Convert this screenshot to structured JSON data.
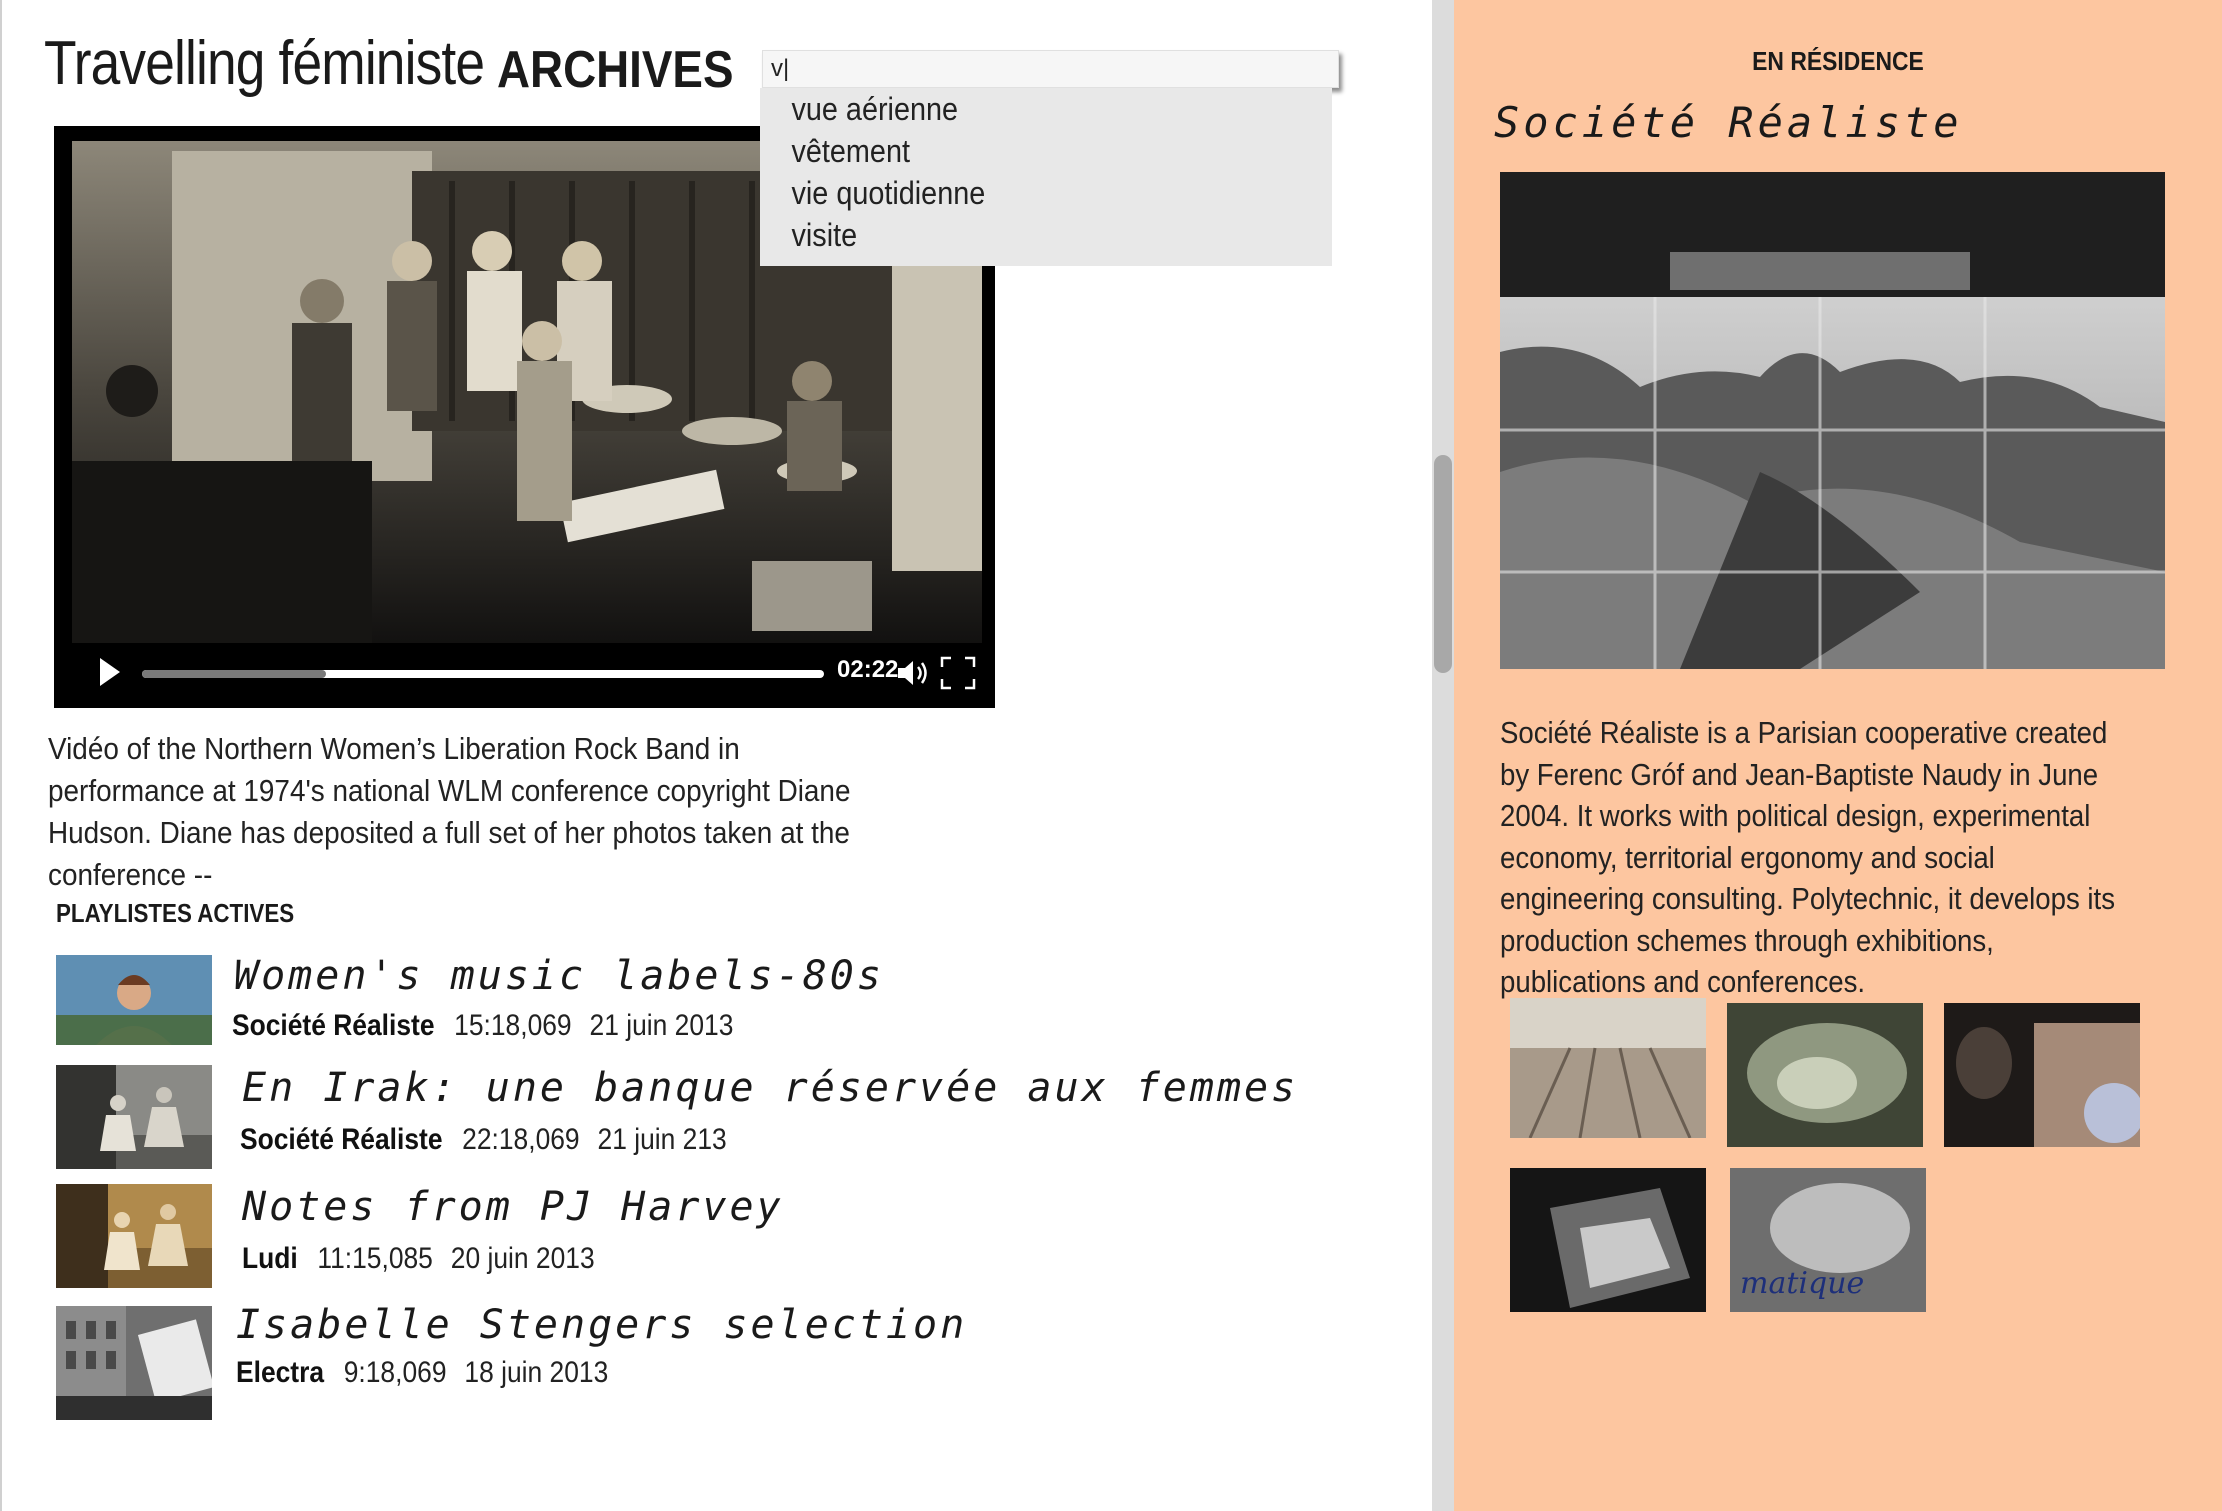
{
  "header": {
    "site_title": "Travelling féministe",
    "section_title": "ARCHIVES"
  },
  "search": {
    "value": "v|",
    "suggestions": [
      "vue aérienne",
      "vêtement",
      "vie quotidienne",
      "visite"
    ]
  },
  "video": {
    "time": "02:22",
    "progress": 0.27,
    "caption": "Vidéo of the Northern Women’s Liberation Rock Band in performance at 1974's national WLM conference copyright Diane Hudson. Diane has deposited a full set of her photos taken at the conference --"
  },
  "playlists": {
    "heading": "PLAYLISTES ACTIVES",
    "items": [
      {
        "title": "Women's music labels-80s",
        "author": "Société Réaliste",
        "duration": "15:18,069",
        "date": "21 juin 2013"
      },
      {
        "title": "En Irak: une banque réservée aux femmes",
        "author": "Société Réaliste",
        "duration": "22:18,069",
        "date": "21 juin 213"
      },
      {
        "title": "Notes from PJ Harvey",
        "author": "Ludi",
        "duration": "11:15,085",
        "date": "20 juin 2013"
      },
      {
        "title": "Isabelle Stengers selection",
        "author": "Electra",
        "duration": "9:18,069",
        "date": "18 juin 2013"
      }
    ]
  },
  "residence": {
    "label": "EN RÉSIDENCE",
    "title": "Société Réaliste",
    "description": "Société Réaliste is a Parisian cooperative created by Ferenc Gróf and Jean-Baptiste Naudy in June 2004. It works with political design, experimental economy, territorial ergonomy and social engineering consulting. Polytechnic, it develops its production schemes through exhibitions, publications and conferences.",
    "image_text": "matique"
  },
  "colors": {
    "right_panel_bg": "#fdc6a0",
    "dropdown_bg": "#e8e8e8",
    "scrollbar_track": "#dcdcdc",
    "scrollbar_thumb": "#a8a8a8"
  }
}
